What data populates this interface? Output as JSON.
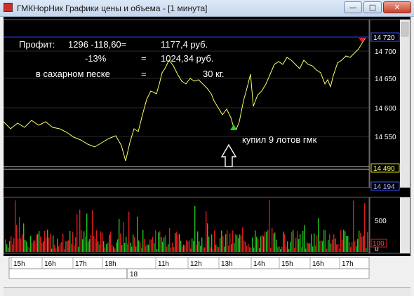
{
  "window": {
    "title": "ГМКНорНик Графики цены и объема - [1 минута]",
    "icon": "chart-app-icon",
    "buttons": {
      "minimize": "—",
      "maximize": "□",
      "close": "✕"
    }
  },
  "colors": {
    "background": "#000000",
    "price_line": "#ffff66",
    "grid": "#5a5a5a",
    "volume_up": "#1fc21f",
    "volume_down": "#d81c1c",
    "annotation_text": "#ffffff",
    "current_price_line": "#3040ff"
  },
  "annotations": {
    "line1": {
      "label": "Профит:",
      "calc": "1296  -118,60=",
      "result": "1177,4 руб."
    },
    "line2": {
      "percent": "-13%",
      "eq": "=",
      "result": "1024,34  руб."
    },
    "line3": {
      "label": "в сахарном песке",
      "eq": "=",
      "result": "30 кг."
    },
    "buy_note": "купил 9 лотов гмк"
  },
  "price_panel": {
    "ticks": [
      "14 700",
      "14 650",
      "14 600",
      "14 550"
    ],
    "current_price": "14 720",
    "marked_low": "14 490",
    "bottom_value": "14 194"
  },
  "volume_panel": {
    "ticks": [
      "500",
      "0"
    ],
    "current_volume": "100"
  },
  "time_axis": {
    "hours": [
      "15h",
      "16h",
      "17h",
      "18h",
      "11h",
      "12h",
      "13h",
      "14h",
      "15h",
      "16h",
      "17h"
    ],
    "day_label": "18"
  }
}
